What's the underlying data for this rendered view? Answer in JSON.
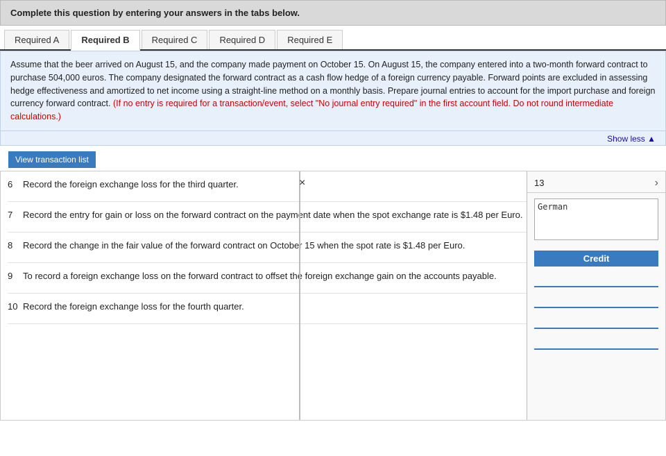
{
  "banner": {
    "text": "Complete this question by entering your answers in the tabs below."
  },
  "tabs": [
    {
      "label": "Required A",
      "active": false
    },
    {
      "label": "Required B",
      "active": true
    },
    {
      "label": "Required C",
      "active": false
    },
    {
      "label": "Required D",
      "active": false
    },
    {
      "label": "Required E",
      "active": false
    }
  ],
  "question_text": "Assume that the beer arrived on August 15, and the company made payment on October 15. On August 15, the company entered into a two-month forward contract to purchase 504,000 euros. The company designated the forward contract as a cash flow hedge of a foreign currency payable. Forward points are excluded in assessing hedge effectiveness and amortized to net income using a straight-line method on a monthly basis. Prepare journal entries to account for the import purchase and foreign currency forward contract.",
  "question_red": "(If no entry is required for a transaction/event, select \"No journal entry required\" in the first account field. Do not round intermediate calculations.)",
  "show_less": "Show less ▲",
  "view_transaction_btn": "View transaction list",
  "close_symbol": "×",
  "rows": [
    {
      "num": "6",
      "desc": "Record the foreign exchange loss for the third quarter."
    },
    {
      "num": "7",
      "desc": "Record the entry for gain or loss on the forward contract on the payment date when the spot exchange rate is $1.48 per Euro."
    },
    {
      "num": "8",
      "desc": "Record the change in the fair value of the forward contract on October 15 when the spot rate is $1.48 per Euro."
    },
    {
      "num": "9",
      "desc": "To record a foreign exchange loss on the forward contract to offset the foreign exchange gain on the accounts payable."
    },
    {
      "num": "10",
      "desc": "Record the foreign exchange loss for the fourth quarter."
    }
  ],
  "right_panel": {
    "number": "13",
    "text_value": "German",
    "credit_label": "Credit",
    "inputs": [
      "",
      "",
      "",
      ""
    ]
  }
}
